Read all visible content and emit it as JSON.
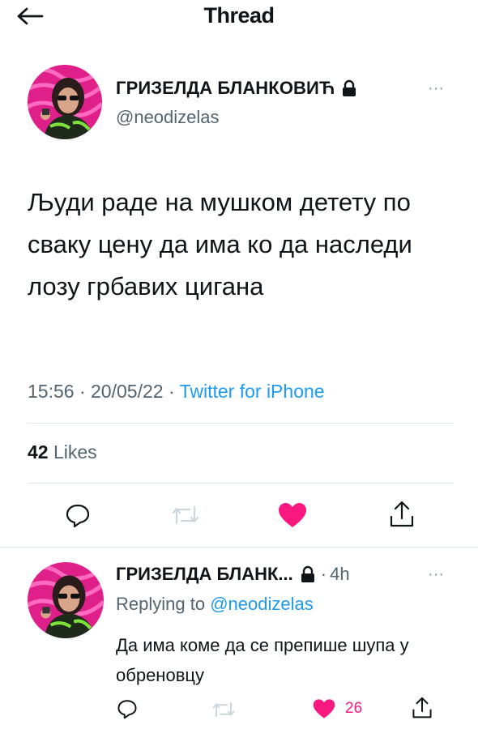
{
  "header": {
    "title": "Thread",
    "back_icon": "arrow-left-icon"
  },
  "main_tweet": {
    "author_name": "ГРИЗЕЛДА БЛАНКОВИЋ",
    "handle": "@neodizelas",
    "text": "Људи раде на мушком детету по сваку цену да има ко да наследи лозу грбавих цигана",
    "time": "15:56",
    "date": "20/05/22",
    "separator": "·",
    "source": "Twitter for iPhone",
    "likes_count": "42",
    "likes_label": "Likes",
    "icons": [
      "reply-icon",
      "retweet-icon",
      "heart-filled-icon",
      "share-icon"
    ]
  },
  "reply_tweet": {
    "author_name": "ГРИЗЕЛДА БЛАНК...",
    "separator": "·",
    "time": "4h",
    "replying_prefix": "Replying to",
    "replying_to": "@neodizelas",
    "text": "Да има коме да се препише шупа у обреновцу",
    "like_count": "26"
  },
  "colors": {
    "accent": "#1d9bf0",
    "like": "#f91880",
    "muted": "#536471",
    "divider": "#e1e8ed",
    "text": "#0f1419"
  }
}
